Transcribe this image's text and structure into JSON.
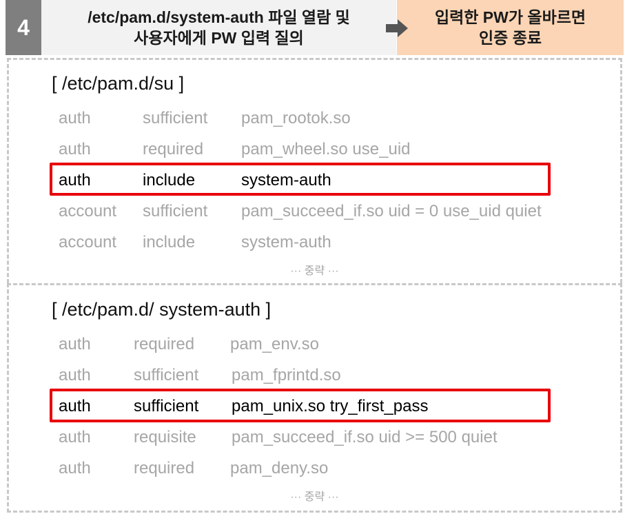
{
  "step": {
    "number": "4",
    "description_line1": "/etc/pam.d/system-auth 파일 열람 및",
    "description_line2": "사용자에게 PW 입력 질의",
    "result_line1": "입력한 PW가 올바르면",
    "result_line2": "인증 종료"
  },
  "colors": {
    "highlight": "#e8000b",
    "result_bg": "#fbd5b5",
    "step_bg": "#7f7f7f"
  },
  "su_file": {
    "title": "[ /etc/pam.d/su ]",
    "rows": [
      {
        "type": "auth",
        "control": "sufficient",
        "module": "pam_rootok.so"
      },
      {
        "type": "auth",
        "control": "required",
        "module": "pam_wheel.so use_uid"
      },
      {
        "type": "auth",
        "control": "include",
        "module": "system-auth"
      },
      {
        "type": "account",
        "control": "sufficient",
        "module": "pam_succeed_if.so uid = 0 use_uid quiet"
      },
      {
        "type": "account",
        "control": "include",
        "module": "system-auth"
      }
    ],
    "omit_text": "··· 중략 ···"
  },
  "system_auth_file": {
    "title": "[ /etc/pam.d/ system-auth ]",
    "rows": [
      {
        "type": "auth",
        "control": "required",
        "module": "pam_env.so"
      },
      {
        "type": "auth",
        "control": "sufficient",
        "module": "pam_fprintd.so"
      },
      {
        "type": "auth",
        "control": "sufficient",
        "module": "pam_unix.so try_first_pass"
      },
      {
        "type": "auth",
        "control": "requisite",
        "module": "pam_succeed_if.so uid >= 500 quiet"
      },
      {
        "type": "auth",
        "control": "required",
        "module": "pam_deny.so"
      }
    ],
    "omit_text": "··· 중략 ···"
  }
}
